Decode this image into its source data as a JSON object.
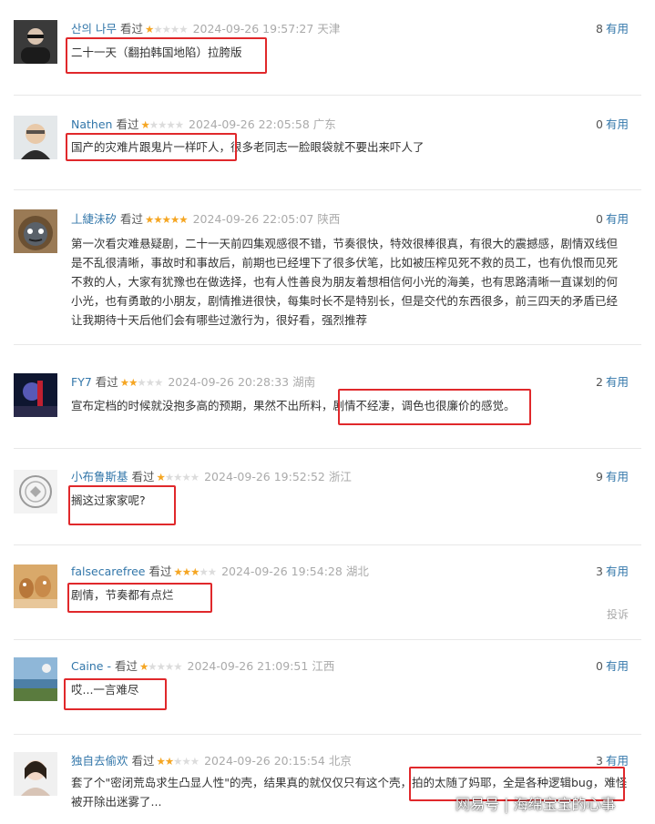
{
  "reviews": [
    {
      "user": "산의 나무",
      "watched": "看过",
      "stars": 1,
      "time": "2024-09-26 19:57:27",
      "place": "天津",
      "useful_count": "8",
      "useful_label": "有用",
      "text": "二十一天（翻拍韩国地陷）拉胯版"
    },
    {
      "user": "Nathen",
      "watched": "看过",
      "stars": 1,
      "time": "2024-09-26 22:05:58",
      "place": "广东",
      "useful_count": "0",
      "useful_label": "有用",
      "text": "国产的灾难片跟鬼片一样吓人，很多老同志一脸眼袋就不要出来吓人了"
    },
    {
      "user": "丄緁沬矽",
      "watched": "看过",
      "stars": 5,
      "time": "2024-09-26 22:05:07",
      "place": "陕西",
      "useful_count": "0",
      "useful_label": "有用",
      "text": "第一次看灾难悬疑剧，二十一天前四集观感很不错，节奏很快，特效很棒很真，有很大的震撼感，剧情双线但是不乱很清晰，事故时和事故后，前期也已经埋下了很多伏笔，比如被压榨见死不救的员工，也有仇恨而见死不救的人，大家有犹豫也在做选择，也有人性善良为朋友着想相信何小光的海美，也有思路清晰一直谋划的何小光，也有勇敢的小朋友，剧情推进很快，每集时长不是特别长，但是交代的东西很多，前三四天的矛盾已经让我期待十天后他们会有哪些过激行为，很好看，强烈推荐"
    },
    {
      "user": "FY7",
      "watched": "看过",
      "stars": 2,
      "time": "2024-09-26 20:28:33",
      "place": "湖南",
      "useful_count": "2",
      "useful_label": "有用",
      "text": "宣布定档的时候就没抱多高的预期，果然不出所料，剧情不经凄，调色也很廉价的感觉。"
    },
    {
      "user": "小布鲁斯基",
      "watched": "看过",
      "stars": 1,
      "time": "2024-09-26 19:52:52",
      "place": "浙江",
      "useful_count": "9",
      "useful_label": "有用",
      "text": "搁这过家家呢?"
    },
    {
      "user": "falsecarefree",
      "watched": "看过",
      "stars": 3,
      "time": "2024-09-26 19:54:28",
      "place": "湖北",
      "useful_count": "3",
      "useful_label": "有用",
      "text": "剧情，节奏都有点烂",
      "report": "投诉"
    },
    {
      "user": "Caine -",
      "watched": "看过",
      "stars": 1,
      "time": "2024-09-26 21:09:51",
      "place": "江西",
      "useful_count": "0",
      "useful_label": "有用",
      "text": "哎...一言难尽"
    },
    {
      "user": "独自去偷欢",
      "watched": "看过",
      "stars": 2,
      "time": "2024-09-26 20:15:54",
      "place": "北京",
      "useful_count": "3",
      "useful_label": "有用",
      "text": "套了个\"密闭荒岛求生凸显人性\"的壳，结果真的就仅仅只有这个壳，拍的太随了妈耶，全是各种逻辑bug，难怪被开除出迷雾了..."
    }
  ],
  "watermark": "网易号 | 海绵宝宝的心事",
  "colors": {
    "link": "#3377aa",
    "star": "#f5a623",
    "highlight": "#e0282b"
  }
}
